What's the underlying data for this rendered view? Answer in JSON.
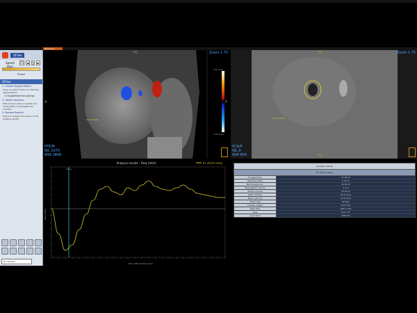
{
  "window": {
    "tab_title": "QFlow 8.1"
  },
  "sidebar": {
    "app_name": "QFlow",
    "speed_label": "Speed (fps)",
    "speed_value": "25",
    "phase_label": "Phase",
    "section_header": "QFlow",
    "step1": "1. Create Segmentation",
    "step1_text": "Draw an initial contour to start the segmentation",
    "option_label": "Show/Hide the overlay",
    "step2": "2. Verify Contours",
    "step2_text": "Edit contours where needed and verify/ratify or propagate the contours",
    "step3": "3. Review Results",
    "step3_text": "Examine graphs and values of the analysis results",
    "status": "No Studies"
  },
  "viewport1": {
    "zoom": "Zoom 1.75",
    "top": "FC",
    "left": "A",
    "right": "P",
    "wl1": "FFE/M",
    "wl2": "WL  1070",
    "wl3": "WW  1868",
    "cb_top": "170 cm/s",
    "cb_bot": "-170 cm/s",
    "roi_label": "Aorta phase"
  },
  "viewport2": {
    "zoom": "Zoom 1.75",
    "top": "FC",
    "bottom": "FC",
    "wl1": "PCA/P",
    "wl2": "WL  0",
    "wl3": "WW  800",
    "roi_label": "Aorta phase"
  },
  "graph": {
    "title": "Analysis results - Flow [ml/s]",
    "legend": "A1 (Aorta valve)",
    "xlabel": "Time after R-wave [ms]",
    "ylabel": "Flow [ml/s]",
    "marker": "Phase"
  },
  "results": {
    "header": "Analysis results",
    "subheader": "A1 (Aorta valve)",
    "rows": [
      {
        "k": "Forward flow",
        "v": "71.36 ml"
      },
      {
        "k": "Backward flow",
        "v": "1.21 ml"
      },
      {
        "k": "Net forward vol.",
        "v": "70.15 ml"
      },
      {
        "k": "Regurgitant fraction",
        "v": "1.7 %"
      },
      {
        "k": "Stroke volume",
        "v": "70.15 ml"
      },
      {
        "k": "Peak velocity",
        "v": "91.2 cm/s"
      },
      {
        "k": "Mean velocity",
        "v": "12.4 cm/s"
      },
      {
        "k": "Heart rate",
        "v": "60 bpm"
      },
      {
        "k": "Cardiac output",
        "v": "4.21 l/min"
      },
      {
        "k": "Peak flow",
        "v": "342.5 ml/s"
      },
      {
        "k": "Area",
        "v": "5.12 cm²"
      },
      {
        "k": "Cycle time",
        "v": "1000 ms"
      }
    ]
  },
  "colors": {
    "curve": "#d8c830",
    "marker": "#3ab0c8",
    "accent": "#4aa3ff"
  },
  "chart_data": {
    "type": "line",
    "x": [
      0,
      40,
      80,
      120,
      160,
      200,
      240,
      280,
      320,
      360,
      400,
      440,
      480,
      520,
      560,
      600,
      640,
      680,
      720,
      760,
      800,
      840,
      880,
      920,
      960,
      1000
    ],
    "values": [
      0,
      -180,
      -300,
      -260,
      -150,
      -40,
      60,
      140,
      160,
      120,
      100,
      150,
      130,
      170,
      200,
      160,
      140,
      130,
      150,
      170,
      140,
      110,
      100,
      90,
      80,
      80
    ],
    "xlabel": "Time after R-wave [ms]",
    "ylabel": "Flow [ml/s]",
    "ylim": [
      -350,
      300
    ],
    "legend": "top-right"
  }
}
